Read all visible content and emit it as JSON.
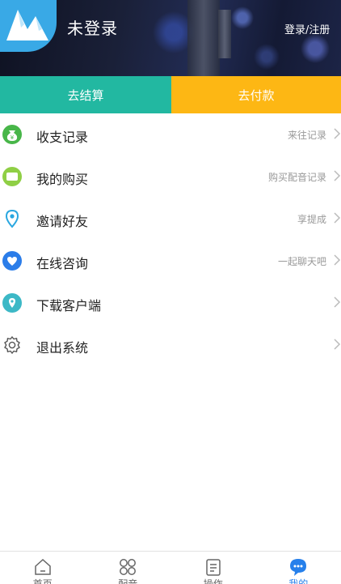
{
  "header": {
    "username": "未登录",
    "login_link": "登录/注册"
  },
  "actions": {
    "checkout_label": "去结算",
    "pay_label": "去付款"
  },
  "menu": {
    "items": [
      {
        "label": "收支记录",
        "hint": "来往记录",
        "icon": "money-bag-icon"
      },
      {
        "label": "我的购买",
        "hint": "购买配音记录",
        "icon": "card-icon"
      },
      {
        "label": "邀请好友",
        "hint": "享提成",
        "icon": "location-pin-icon"
      },
      {
        "label": "在线咨询",
        "hint": "一起聊天吧",
        "icon": "heart-icon"
      },
      {
        "label": "下载客户端",
        "hint": "",
        "icon": "download-pin-icon"
      },
      {
        "label": "退出系统",
        "hint": "",
        "icon": "gear-icon"
      }
    ]
  },
  "tabbar": {
    "tabs": [
      {
        "label": "首页",
        "icon": "home-icon"
      },
      {
        "label": "配音",
        "icon": "grid-icon"
      },
      {
        "label": "操作",
        "icon": "clipboard-icon"
      },
      {
        "label": "我的",
        "icon": "chat-bubble-icon",
        "active": true
      }
    ]
  },
  "colors": {
    "teal": "#22b8a1",
    "amber": "#fdb714",
    "blue": "#2680eb",
    "green": "#48b649",
    "light_green": "#8fcf45"
  }
}
